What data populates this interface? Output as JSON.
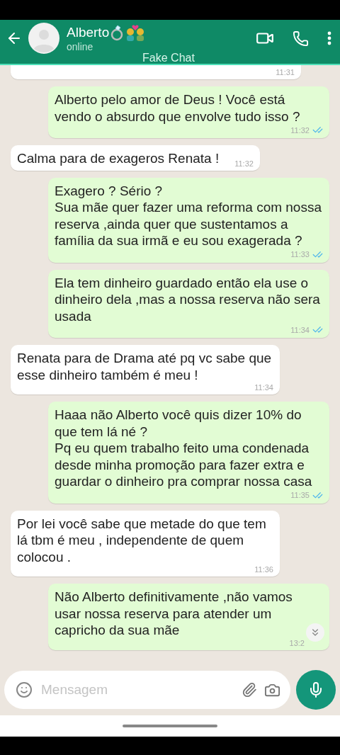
{
  "header": {
    "name": "Alberto",
    "status": "online",
    "label": "Fake Chat"
  },
  "messages": [
    {
      "kind": "incoming",
      "time": "11:31"
    },
    {
      "kind": "outgoing",
      "text": "Alberto pelo amor de Deus ! Você está vendo o absurdo que envolve tudo isso ?",
      "time": "11:32",
      "read": true
    },
    {
      "kind": "incoming",
      "text": "Calma para de exageros Renata !",
      "time": "11:32"
    },
    {
      "kind": "outgoing",
      "text": "Exagero ? Sério ?\nSua mãe quer fazer uma reforma com nossa reserva ,ainda quer que sustentamos a família da sua irmã e eu sou exagerada ?",
      "time": "11:33",
      "read": true
    },
    {
      "kind": "outgoing",
      "text": "Ela tem dinheiro guardado então ela use o dinheiro dela ,mas a nossa reserva não sera usada",
      "time": "11:34",
      "read": true
    },
    {
      "kind": "incoming",
      "text": "Renata para de Drama até pq vc sabe que esse dinheiro também é meu !",
      "time": "11:34"
    },
    {
      "kind": "outgoing",
      "text": "Haaa não Alberto você quis dizer 10% do que tem lá né ?\nPq eu quem trabalho feito uma condenada desde minha promoção  para fazer extra e guardar o dinheiro pra comprar nossa casa",
      "time": "11:35",
      "read": true
    },
    {
      "kind": "incoming",
      "text": "Por lei você sabe que metade do que tem lá tbm é meu , independente de quem colocou .",
      "time": "11:36"
    },
    {
      "kind": "outgoing",
      "text": "Não Alberto definitivamente ,não vamos usar nossa reserva para atender um capricho da sua mãe",
      "time": "13:2"
    }
  ],
  "composer": {
    "placeholder": "Mensagem"
  }
}
